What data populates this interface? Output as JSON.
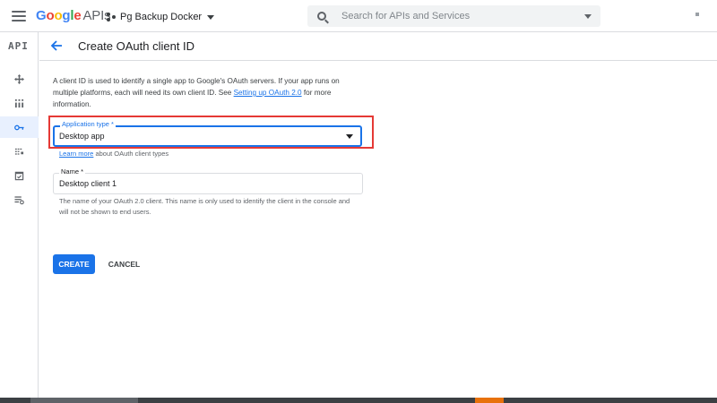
{
  "topbar": {
    "logo_google": "Google",
    "logo_apis": "APIs",
    "project_name": "Pg Backup Docker",
    "search_placeholder": "Search for APIs and Services"
  },
  "leftnav": {
    "badge": "API",
    "items": [
      {
        "icon": "dashboard-icon",
        "active": false
      },
      {
        "icon": "library-icon",
        "active": false
      },
      {
        "icon": "key-icon",
        "active": true
      },
      {
        "icon": "oauth-consent-icon",
        "active": false
      },
      {
        "icon": "domain-verification-icon",
        "active": false
      },
      {
        "icon": "page-usage-icon",
        "active": false
      }
    ]
  },
  "header": {
    "title": "Create OAuth client ID"
  },
  "form": {
    "intro_text_1": "A client ID is used to identify a single app to Google's OAuth servers. If your app runs on multiple platforms, each will need its own client ID. See ",
    "intro_link": "Setting up OAuth 2.0",
    "intro_text_2": " for more information.",
    "app_type_label": "Application type *",
    "app_type_value": "Desktop app",
    "learn_more_link": "Learn more",
    "learn_more_text": " about OAuth client types",
    "name_label": "Name *",
    "name_value": "Desktop client 1",
    "name_help": "The name of your OAuth 2.0 client. This name is only used to identify the client in the console and will not be shown to end users.",
    "create_label": "CREATE",
    "cancel_label": "CANCEL"
  },
  "colors": {
    "accent": "#1a73e8",
    "highlight_box": "#e53935"
  }
}
